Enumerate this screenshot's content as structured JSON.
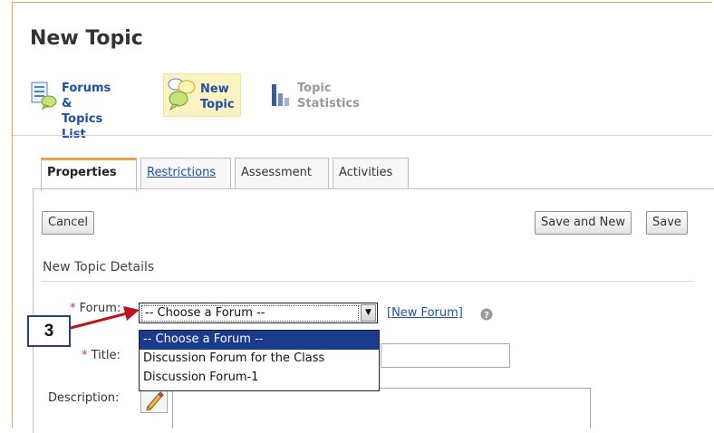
{
  "page_title": "New Topic",
  "toolbar": {
    "forums_list_line1": "Forums &",
    "forums_list_line2": "Topics List",
    "new_topic_line1": "New",
    "new_topic_line2": "Topic",
    "topic_statistics": "Topic Statistics"
  },
  "tabs": {
    "properties": "Properties",
    "restrictions": "Restrictions",
    "assessment": "Assessment",
    "activities": "Activities"
  },
  "buttons": {
    "cancel": "Cancel",
    "save_and_new": "Save and New",
    "save": "Save"
  },
  "section_title": "New Topic Details",
  "form": {
    "required_mark": "*",
    "forum_label": "Forum:",
    "forum_selected": "-- Choose a Forum --",
    "forum_options": [
      "-- Choose a Forum --",
      "Discussion Forum for the Class",
      "Discussion Forum-1"
    ],
    "new_forum_link": "[New Forum]",
    "title_label": "Title:",
    "title_value": "",
    "description_label": "Description:"
  },
  "annotation": {
    "step_number": "3",
    "arrow_color": "#c0141c"
  },
  "colors": {
    "accent_orange": "#e8a24a",
    "link_blue": "#1f4fa8",
    "selection_blue": "#1a3a8c"
  }
}
